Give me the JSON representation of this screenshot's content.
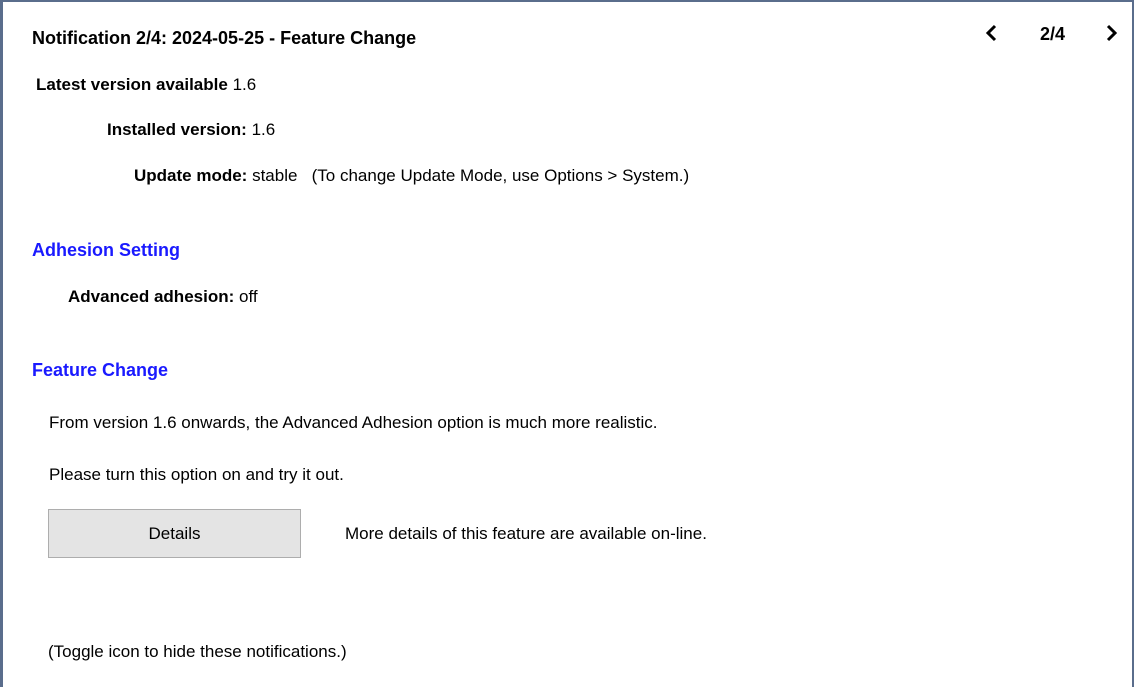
{
  "header": {
    "title": "Notification 2/4: 2024-05-25 - Feature Change",
    "nav_prev": "‹",
    "nav_count": "2/4",
    "nav_next": "›"
  },
  "version_info": {
    "latest_label": "Latest version available",
    "latest_value": "1.6",
    "installed_label": "Installed version:",
    "installed_value": "1.6",
    "update_mode_label": "Update mode:",
    "update_mode_value": "stable",
    "update_mode_hint": "(To change Update Mode, use Options > System.)"
  },
  "adhesion": {
    "heading": "Adhesion Setting",
    "label": "Advanced adhesion:",
    "value": "off"
  },
  "feature": {
    "heading": "Feature Change",
    "line1": "From version 1.6 onwards, the Advanced Adhesion option is much more realistic.",
    "line2": "Please turn this option on and try it out.",
    "details_button": "Details",
    "details_note": "More details of this feature are available on-line."
  },
  "footer": {
    "toggle_note": "(Toggle icon to hide these notifications.)"
  },
  "colors": {
    "section_heading": "#1a1aff",
    "frame_border": "#5a6d8c",
    "button_bg": "#e4e4e4"
  }
}
